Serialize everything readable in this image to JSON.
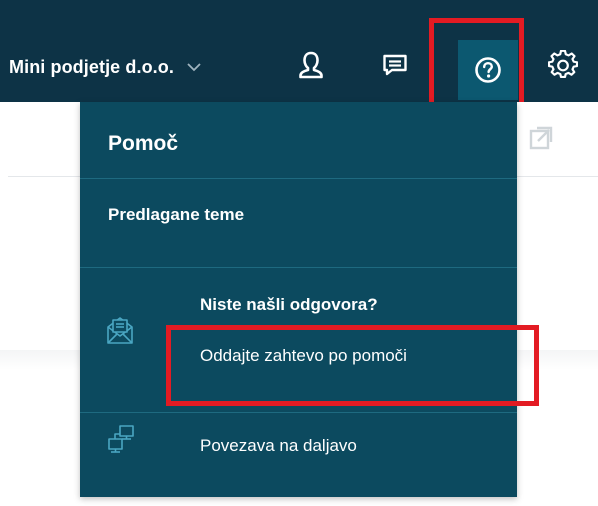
{
  "header": {
    "company_name": "Mini podjetje d.o.o.",
    "icons": [
      "user-icon",
      "messages-icon",
      "help-icon",
      "settings-icon"
    ],
    "active_icon": "help-icon",
    "highlight_color": "#e31b23"
  },
  "help_menu": {
    "title": "Pomoč",
    "suggested_topics": "Predlagane teme",
    "no_answer_heading": "Niste našli odgovora?",
    "submit_request": "Oddajte zahtevo po pomoči",
    "remote_connection": "Povezava na daljavo"
  },
  "colors": {
    "topbar": "#0d3346",
    "menu_background": "#0c4a5f",
    "active_icon_background": "#0c5870",
    "highlight": "#e31b23"
  }
}
